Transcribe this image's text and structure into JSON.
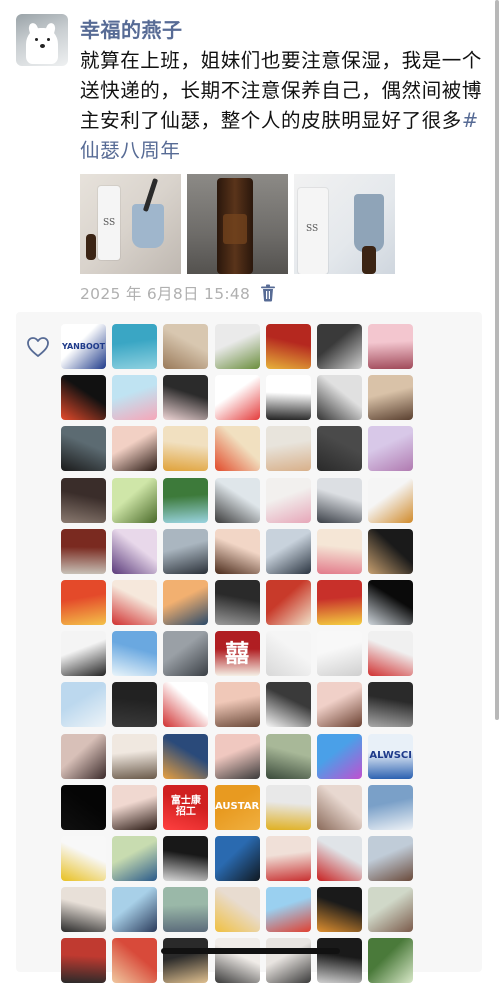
{
  "post": {
    "author": "幸福的燕子",
    "text_body": "就算在上班，姐妹们也要注意保湿，我是一个送快递的，长期不注意保养自己，偶然间被博主安利了仙瑟，整个人的皮肤明显好了很多",
    "hashtag": "#仙瑟八周年",
    "timestamp": "2025 年 6月8日 15:48",
    "photos": [
      {
        "icon": "product-photo-bottle-and-cup"
      },
      {
        "icon": "product-photo-amber-bottle"
      },
      {
        "icon": "product-photo-bottles-and-mug"
      }
    ]
  },
  "likes": {
    "icon": "heart-outline-icon",
    "avatars": [
      {
        "colors": [
          "#ffffff",
          "#1e3a8a"
        ],
        "label": "YANBOOT"
      },
      {
        "colors": [
          "#3aa6c4",
          "#8fd1e0"
        ]
      },
      {
        "colors": [
          "#d8c7b0",
          "#9a7a5a"
        ]
      },
      {
        "colors": [
          "#eaeaea",
          "#6b8e3d"
        ]
      },
      {
        "colors": [
          "#b5281f",
          "#e7b23a"
        ]
      },
      {
        "colors": [
          "#3a3a3a",
          "#cfcfcf"
        ]
      },
      {
        "colors": [
          "#f3c6cf",
          "#a04a5a"
        ]
      },
      {
        "colors": [
          "#111111",
          "#e64b2b"
        ]
      },
      {
        "colors": [
          "#bfe3f2",
          "#f6a6b8"
        ]
      },
      {
        "colors": [
          "#2b2b2b",
          "#f0d6d6"
        ]
      },
      {
        "colors": [
          "#ffffff",
          "#e43b3b"
        ]
      },
      {
        "colors": [
          "#ffffff",
          "#222222"
        ]
      },
      {
        "colors": [
          "#e0e0e0",
          "#333333"
        ]
      },
      {
        "colors": [
          "#d9c2a8",
          "#5a4030"
        ]
      },
      {
        "colors": [
          "#5c6b72",
          "#1a1a1a"
        ]
      },
      {
        "colors": [
          "#f2d0c4",
          "#2a1a14"
        ]
      },
      {
        "colors": [
          "#f1e0c0",
          "#e0a23a"
        ]
      },
      {
        "colors": [
          "#f1e0c0",
          "#e14a2a"
        ]
      },
      {
        "colors": [
          "#e8e4dc",
          "#d8b08a"
        ]
      },
      {
        "colors": [
          "#4a4a4a",
          "#2a2a2a"
        ]
      },
      {
        "colors": [
          "#d8c8e8",
          "#b07ab0"
        ]
      },
      {
        "colors": [
          "#3a2d2a",
          "#8a7a70"
        ]
      },
      {
        "colors": [
          "#cfe6a8",
          "#4a6a2a"
        ]
      },
      {
        "colors": [
          "#3d7a3a",
          "#9ad4e0"
        ]
      },
      {
        "colors": [
          "#dfe6ea",
          "#3a3a3a"
        ]
      },
      {
        "colors": [
          "#f2f0ee",
          "#e6a6b8"
        ]
      },
      {
        "colors": [
          "#dcdfe3",
          "#3a3f47"
        ]
      },
      {
        "colors": [
          "#f5f5f5",
          "#d08a2a"
        ]
      },
      {
        "colors": [
          "#7a2a20",
          "#c8c2b8"
        ]
      },
      {
        "colors": [
          "#e8d8ea",
          "#5a3a7a"
        ]
      },
      {
        "colors": [
          "#aab6c0",
          "#2a3038"
        ]
      },
      {
        "colors": [
          "#f2d6c6",
          "#4a2a1a"
        ]
      },
      {
        "colors": [
          "#c8d2dc",
          "#2a3440"
        ]
      },
      {
        "colors": [
          "#f5e6d6",
          "#e27a8a"
        ]
      },
      {
        "colors": [
          "#1a1a1a",
          "#c8a070"
        ]
      },
      {
        "colors": [
          "#e44a2a",
          "#f4c24a"
        ]
      },
      {
        "colors": [
          "#f6e8dc",
          "#d03030"
        ]
      },
      {
        "colors": [
          "#f2b070",
          "#2a4a6a"
        ]
      },
      {
        "colors": [
          "#2a2a2a",
          "#9a9a9a"
        ]
      },
      {
        "colors": [
          "#c83a2a",
          "#f0e0c8"
        ]
      },
      {
        "colors": [
          "#c8302a",
          "#f5d040"
        ]
      },
      {
        "colors": [
          "#0a0a0a",
          "#cfd6dc"
        ]
      },
      {
        "colors": [
          "#f4f4f4",
          "#222222"
        ]
      },
      {
        "colors": [
          "#6aa8e0",
          "#e8f4fa"
        ]
      },
      {
        "colors": [
          "#9aa0a6",
          "#3a3f45"
        ]
      },
      {
        "colors": [
          "#b01e22",
          "#f5f0e6"
        ],
        "label": "囍"
      },
      {
        "colors": [
          "#f5f5f5",
          "#d8d8d8"
        ]
      },
      {
        "colors": [
          "#f8f8f8",
          "#cfcfcf"
        ]
      },
      {
        "colors": [
          "#f0f0f0",
          "#d03030"
        ]
      },
      {
        "colors": [
          "#bcd8ee",
          "#eef4f8"
        ]
      },
      {
        "colors": [
          "#222222",
          "#3a3a3a"
        ]
      },
      {
        "colors": [
          "#ffffff",
          "#d03030"
        ]
      },
      {
        "colors": [
          "#f0c8b8",
          "#6a4a3a"
        ]
      },
      {
        "colors": [
          "#3a3a3a",
          "#f8f8f8"
        ]
      },
      {
        "colors": [
          "#f0d0c8",
          "#6a4030"
        ]
      },
      {
        "colors": [
          "#2a2a2a",
          "#a8a8a8"
        ]
      },
      {
        "colors": [
          "#d8c0b8",
          "#3a2a2a"
        ]
      },
      {
        "colors": [
          "#f0e8e0",
          "#6a5a4a"
        ]
      },
      {
        "colors": [
          "#2a4a7a",
          "#e8a040"
        ]
      },
      {
        "colors": [
          "#f0c8c0",
          "#3a3a3a"
        ]
      },
      {
        "colors": [
          "#a8b898",
          "#3a4a3a"
        ]
      },
      {
        "colors": [
          "#4aa0e8",
          "#c050d0"
        ]
      },
      {
        "colors": [
          "#e8f0f8",
          "#2a60b0"
        ],
        "label": "ALWSCI"
      },
      {
        "colors": [
          "#050505",
          "#101010"
        ]
      },
      {
        "colors": [
          "#f0d8d0",
          "#2a1a14"
        ]
      },
      {
        "colors": [
          "#d02020",
          "#ff4040"
        ],
        "label": "富士康\n招工"
      },
      {
        "colors": [
          "#e89a20",
          "#f0b040"
        ],
        "label": "AUSTAR"
      },
      {
        "colors": [
          "#e8e8e8",
          "#e0b020"
        ]
      },
      {
        "colors": [
          "#e8d8d0",
          "#8a6a5a"
        ]
      },
      {
        "colors": [
          "#7aa0c8",
          "#eef2f6"
        ]
      },
      {
        "colors": [
          "#f8f8f8",
          "#e8c020"
        ]
      },
      {
        "colors": [
          "#c8dcb0",
          "#2a5a8a"
        ]
      },
      {
        "colors": [
          "#181818",
          "#d8d8d8"
        ]
      },
      {
        "colors": [
          "#2a6ab0",
          "#101820"
        ]
      },
      {
        "colors": [
          "#f0e0d8",
          "#c83030"
        ]
      },
      {
        "colors": [
          "#e0e4e8",
          "#c82020"
        ]
      },
      {
        "colors": [
          "#c0ccd8",
          "#6a4a3a"
        ]
      },
      {
        "colors": [
          "#e8e0d8",
          "#2a2a2a"
        ]
      },
      {
        "colors": [
          "#a8d0e8",
          "#2a3a5a"
        ]
      },
      {
        "colors": [
          "#9ab8a8",
          "#5a6a7a"
        ]
      },
      {
        "colors": [
          "#e8dcd0",
          "#f0c040"
        ]
      },
      {
        "colors": [
          "#9ad0f0",
          "#e04030"
        ]
      },
      {
        "colors": [
          "#1a1a1a",
          "#e09030"
        ]
      },
      {
        "colors": [
          "#d0d8c8",
          "#7a5a4a"
        ]
      },
      {
        "colors": [
          "#c03a30",
          "#2a2a2a"
        ]
      },
      {
        "colors": [
          "#d84a3a",
          "#f0c8a0"
        ]
      },
      {
        "colors": [
          "#2a2a2a",
          "#e0c090"
        ]
      },
      {
        "colors": [
          "#f0ece8",
          "#3a3a3a"
        ]
      },
      {
        "colors": [
          "#e8e4e0",
          "#3a3a3a"
        ]
      },
      {
        "colors": [
          "#1a1a1a",
          "#d0d0d0"
        ]
      },
      {
        "colors": [
          "#4a7a3a",
          "#d8e8c8"
        ]
      }
    ]
  }
}
